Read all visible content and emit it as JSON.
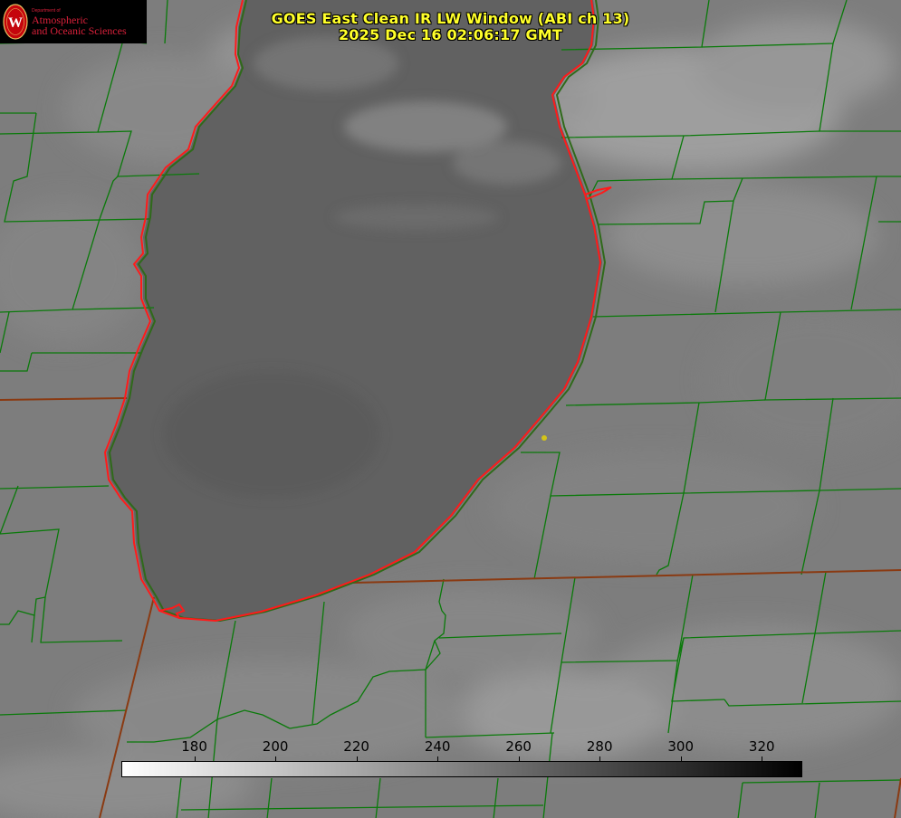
{
  "title": {
    "line1": "GOES East Clean IR LW Window (ABI ch 13)",
    "line2": "2025 Dec 16 02:06:17 GMT",
    "color": "#ffff2a"
  },
  "logo": {
    "dept_small": "Department of",
    "line1": "Atmospheric",
    "line2": "and Oceanic Sciences",
    "seal_letter": "W",
    "text_color": "#d8203a",
    "seal_color": "#c5050c"
  },
  "colorbar": {
    "min": 162,
    "max": 330,
    "ticks": [
      "180",
      "200",
      "220",
      "240",
      "260",
      "280",
      "300",
      "320"
    ],
    "tick_values": [
      180,
      200,
      220,
      240,
      260,
      280,
      300,
      320
    ],
    "gradient": "white-to-black"
  },
  "map": {
    "county_line_color": "#0a7a0a",
    "state_line_color": "#8a3a12",
    "lake_shore_color": "#ff1a1a",
    "marker_color": "#d4c418",
    "lake_fill": "#616161",
    "land_fill": "#7c7c7c"
  }
}
